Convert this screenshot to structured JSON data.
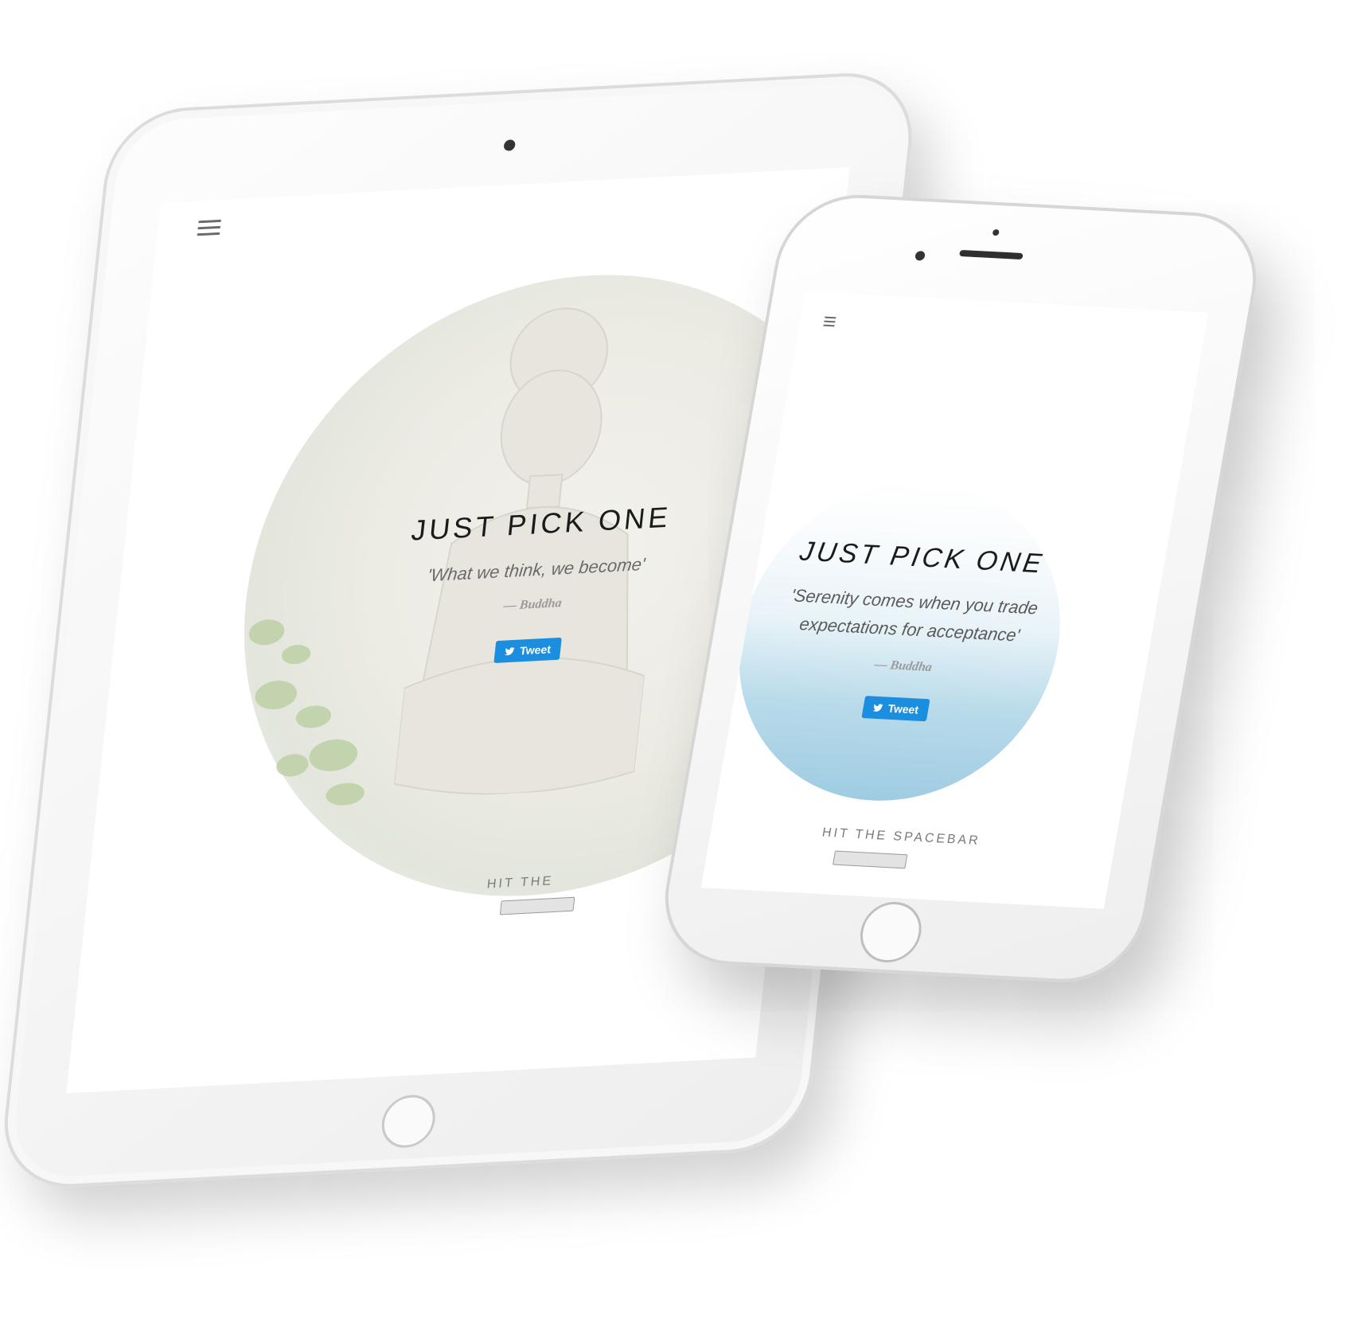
{
  "tablet": {
    "menu_icon": "hamburger-icon",
    "title": "JUST PICK ONE",
    "quote": "'What we think, we become'",
    "author": "— Buddha",
    "tweet_label": "Tweet",
    "tweet_icon": "twitter-bird-icon",
    "spacebar_label": "HIT THE"
  },
  "phone": {
    "menu_icon": "hamburger-icon",
    "title": "JUST PICK ONE",
    "quote": "'Serenity comes when you trade expectations for acceptance'",
    "author": "— Buddha",
    "tweet_label": "Tweet",
    "tweet_icon": "twitter-bird-icon",
    "spacebar_label": "HIT THE SPACEBAR"
  },
  "colors": {
    "tweet_button": "#1b8ee0",
    "title_text": "#1b1b1b",
    "device_frame": "#f5f5f5",
    "phone_circle_water": "#9fcce2"
  }
}
